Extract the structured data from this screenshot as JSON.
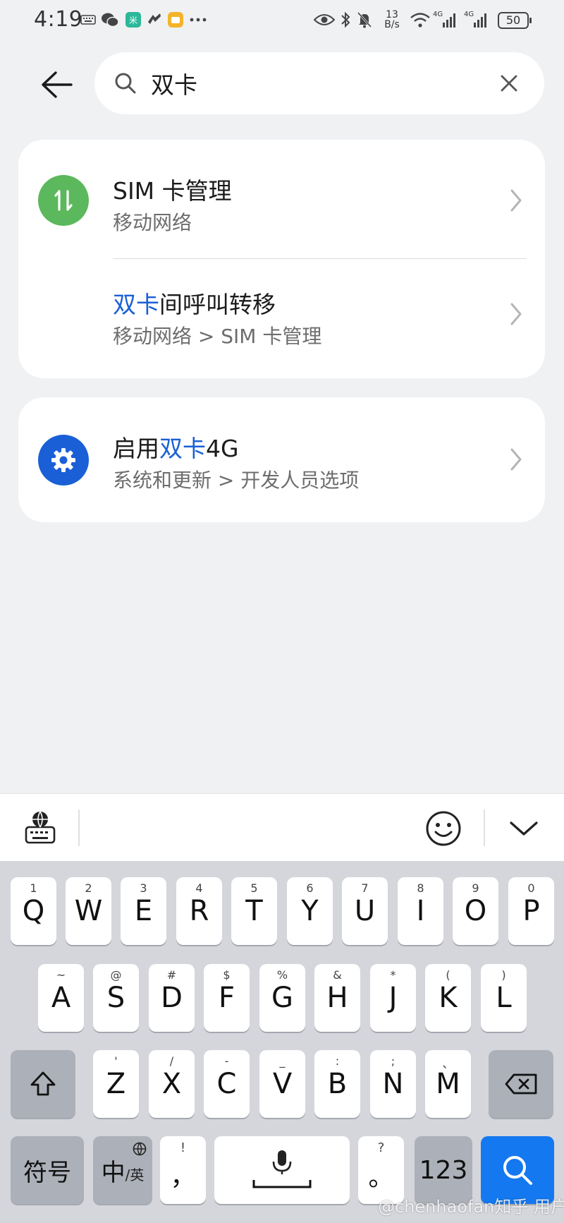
{
  "status_bar": {
    "time": "4:19",
    "net_speed_value": "13",
    "net_speed_unit": "B/s",
    "signal1_label": "4G",
    "signal2_label": "4G",
    "battery": "50"
  },
  "search": {
    "value": "双卡",
    "placeholder": ""
  },
  "results": {
    "card1": {
      "row1": {
        "title": "SIM 卡管理",
        "subtitle": "移动网络",
        "icon_color": "#5cb85c"
      },
      "row2": {
        "title_highlight": "双卡",
        "title_rest": "间呼叫转移",
        "subtitle": "移动网络 > SIM 卡管理"
      }
    },
    "card2": {
      "row1": {
        "title_prefix": "启用",
        "title_highlight": "双卡",
        "title_suffix": "4G",
        "subtitle": "系统和更新 > 开发人员选项",
        "icon_color": "#1a5fd6"
      }
    }
  },
  "keyboard": {
    "row1": [
      {
        "top": "1",
        "main": "Q"
      },
      {
        "top": "2",
        "main": "W"
      },
      {
        "top": "3",
        "main": "E"
      },
      {
        "top": "4",
        "main": "R"
      },
      {
        "top": "5",
        "main": "T"
      },
      {
        "top": "6",
        "main": "Y"
      },
      {
        "top": "7",
        "main": "U"
      },
      {
        "top": "8",
        "main": "I"
      },
      {
        "top": "9",
        "main": "O"
      },
      {
        "top": "0",
        "main": "P"
      }
    ],
    "row2": [
      {
        "top": "~",
        "main": "A"
      },
      {
        "top": "@",
        "main": "S"
      },
      {
        "top": "#",
        "main": "D"
      },
      {
        "top": "$",
        "main": "F"
      },
      {
        "top": "%",
        "main": "G"
      },
      {
        "top": "&",
        "main": "H"
      },
      {
        "top": "*",
        "main": "J"
      },
      {
        "top": "(",
        "main": "K"
      },
      {
        "top": ")",
        "main": "L"
      }
    ],
    "row3": [
      {
        "top": "'",
        "main": "Z"
      },
      {
        "top": "/",
        "main": "X"
      },
      {
        "top": "-",
        "main": "C"
      },
      {
        "top": "_",
        "main": "V"
      },
      {
        "top": ":",
        "main": "B"
      },
      {
        "top": ";",
        "main": "N"
      },
      {
        "top": "、",
        "main": "M"
      }
    ],
    "symbols_label": "符号",
    "lang_main": "中",
    "lang_alt": "/英",
    "comma_top": "!",
    "comma_main": "，",
    "period_top": "?",
    "period_main": "。",
    "num_label": "123",
    "accent_color": "#1478f0"
  },
  "watermark": "@chenhaofan知乎 用户"
}
